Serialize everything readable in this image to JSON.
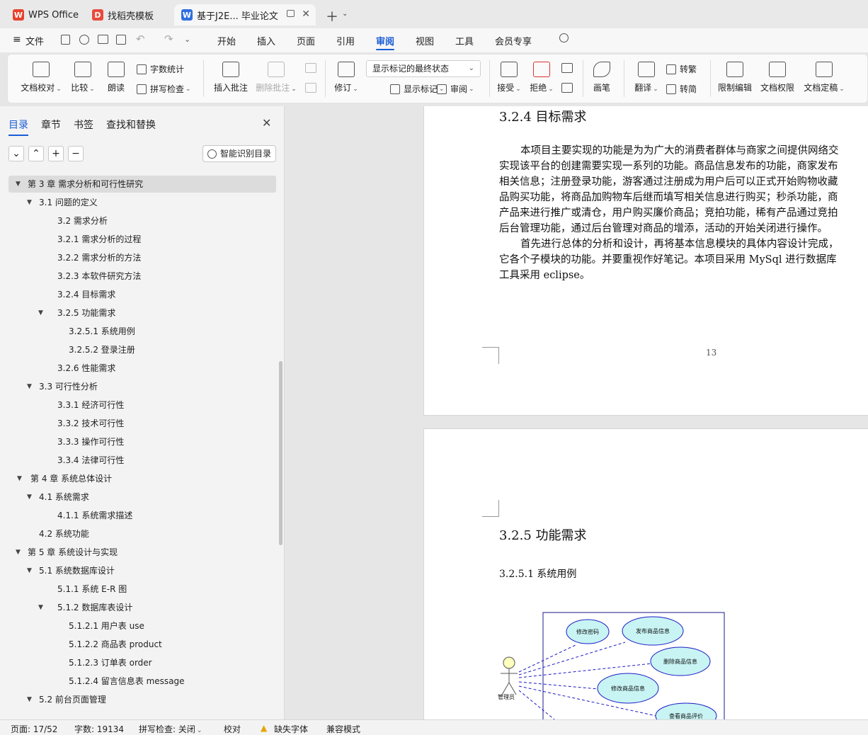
{
  "tabs": [
    {
      "label": "WPS Office",
      "logo": "W"
    },
    {
      "label": "找稻壳模板",
      "logo": "D"
    },
    {
      "label": "基于J2E... 毕业论文",
      "logo": "W"
    }
  ],
  "menu": {
    "file": "文件",
    "items": [
      "开始",
      "插入",
      "页面",
      "引用",
      "审阅",
      "视图",
      "工具",
      "会员专享"
    ],
    "active": "审阅"
  },
  "ribbon": {
    "doc_proofread": "文档校对",
    "compare": "比较",
    "read_aloud": "朗读",
    "word_count": "字数统计",
    "spell_check": "拼写检查",
    "insert_comment": "插入批注",
    "delete_comment": "删除批注",
    "track": "修订",
    "markup_state": "显示标记的最终状态",
    "show_markup": "显示标记",
    "review": "审阅",
    "accept": "接受",
    "reject": "拒绝",
    "pen": "画笔",
    "translate": "翻译",
    "to_traditional": "转繁",
    "to_simplified": "转简",
    "restrict_edit": "限制编辑",
    "doc_rights": "文档权限",
    "doc_finalize": "文档定稿"
  },
  "panel": {
    "tabs": [
      "目录",
      "章节",
      "书签",
      "查找和替换"
    ],
    "smart_btn": "智能识别目录",
    "toc": [
      {
        "text": "第 3 章   需求分析和可行性研究",
        "level": 0,
        "arrow": true,
        "sel": true
      },
      {
        "text": "3.1   问题的定义",
        "level": 1,
        "arrow": true
      },
      {
        "text": "3.2   需求分析",
        "level": 2
      },
      {
        "text": "3.2.1   需求分析的过程",
        "level": 2
      },
      {
        "text": "3.2.2   需求分析的方法",
        "level": 2
      },
      {
        "text": "3.2.3   本软件研究方法",
        "level": 2
      },
      {
        "text": "3.2.4   目标需求",
        "level": 2
      },
      {
        "text": "3.2.5   功能需求",
        "level": 2,
        "arrow": true
      },
      {
        "text": "3.2.5.1   系统用例",
        "level": 3
      },
      {
        "text": "3.2.5.2   登录注册",
        "level": 3
      },
      {
        "text": "3.2.6   性能需求",
        "level": 2
      },
      {
        "text": "3.3   可行性分析",
        "level": 1,
        "arrow": true
      },
      {
        "text": "3.3.1   经济可行性",
        "level": 2
      },
      {
        "text": "3.3.2   技术可行性",
        "level": 2
      },
      {
        "text": "3.3.3   操作可行性",
        "level": 2
      },
      {
        "text": "3.3.4   法律可行性",
        "level": 2
      },
      {
        "text": "第 4 章   系统总体设计",
        "level": 0,
        "arrow": true,
        "indent": 1
      },
      {
        "text": "4.1   系统需求",
        "level": 1,
        "arrow": true
      },
      {
        "text": "4.1.1    系统需求描述",
        "level": 2
      },
      {
        "text": "4.2   系统功能",
        "level": 1
      },
      {
        "text": "第 5 章   系统设计与实现",
        "level": 0,
        "arrow": true
      },
      {
        "text": "5.1  系统数据库设计",
        "level": 1,
        "arrow": true
      },
      {
        "text": "5.1.1   系统 E-R 图",
        "level": 2
      },
      {
        "text": "5.1.2   数据库表设计",
        "level": 2,
        "arrow": true
      },
      {
        "text": "5.1.2.1     用户表 use",
        "level": 3
      },
      {
        "text": "5.1.2.2   商品表 product",
        "level": 3
      },
      {
        "text": "5.1.2.3     订单表 order",
        "level": 3
      },
      {
        "text": "5.1.2.4     留言信息表 message",
        "level": 3
      },
      {
        "text": "5.2   前台页面管理",
        "level": 1,
        "arrow": true
      }
    ]
  },
  "doc": {
    "heading_324": "3.2.4    目标需求",
    "para1": [
      "本项目主要实现的功能是为为广大的消费者群体与商家之间提供网络交",
      "实现该平台的创建需要实现一系列的功能。商品信息发布的功能，商家发布",
      "相关信息；注册登录功能，游客通过注册成为用户后可以正式开始购物收藏",
      "品购买功能，将商品加购物车后继而填写相关信息进行购买；秒杀功能，商",
      "产品来进行推广或清仓，用户购买廉价商品；竞拍功能，稀有产品通过竞拍",
      "后台管理功能，通过后台管理对商品的增添，活动的开始关闭进行操作。"
    ],
    "para2": [
      "首先进行总体的分析和设计，再将基本信息模块的具体内容设计完成，",
      "它各个子模块的功能。并要重视作好笔记。本项目采用 MySql 进行数据库",
      "工具采用 eclipse。"
    ],
    "page_number": "13",
    "heading_325": "3.2.5    功能需求",
    "heading_3251": "3.2.5.1    系统用例",
    "diagram": {
      "actor": "管理员",
      "cases": [
        "修改密码",
        "发布商品信息",
        "删除商品信息",
        "修改商品信息",
        "查看商品评价"
      ]
    }
  },
  "status": {
    "page": "页面: 17/52",
    "words": "字数: 19134",
    "spell": "拼写检查: 关闭",
    "proof": "校对",
    "missing_font": "缺失字体",
    "compat": "兼容模式"
  }
}
